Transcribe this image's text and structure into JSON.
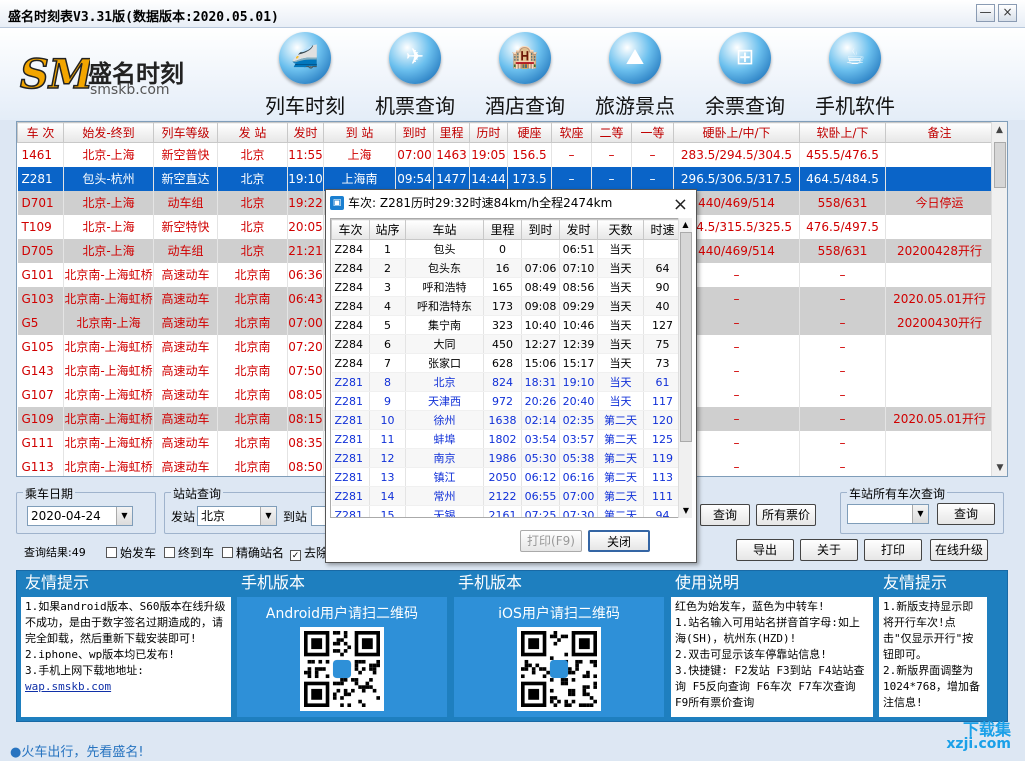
{
  "window": {
    "title": "盛名时刻表V3.31版(数据版本:2020.05.01)",
    "minimize": "—",
    "close": "×"
  },
  "logo": {
    "mark": "SM",
    "name": "盛名时刻",
    "url": "smskb.com"
  },
  "nav": [
    {
      "label": "列车时刻",
      "icon": "train-icon",
      "glyph": "🚄"
    },
    {
      "label": "机票查询",
      "icon": "airplane-icon",
      "glyph": "✈"
    },
    {
      "label": "酒店查询",
      "icon": "hotel-icon",
      "glyph": "🏨"
    },
    {
      "label": "旅游景点",
      "icon": "scenic-icon",
      "glyph": "⛰"
    },
    {
      "label": "余票查询",
      "icon": "windows-icon",
      "glyph": "⊞"
    },
    {
      "label": "手机软件",
      "icon": "java-icon",
      "glyph": "☕"
    }
  ],
  "grid": {
    "columns": [
      "车 次",
      "始发-终到",
      "列车等级",
      "发 站",
      "发时",
      "到 站",
      "到时",
      "里程",
      "历时",
      "硬座",
      "软座",
      "二等",
      "一等",
      "硬卧上/中/下",
      "软卧上/下",
      "备注"
    ],
    "rows": [
      {
        "style": "red",
        "cells": [
          "1461",
          "北京-上海",
          "新空普快",
          "北京",
          "11:55",
          "上海",
          "07:00",
          "1463",
          "19:05",
          "156.5",
          "–",
          "–",
          "–",
          "283.5/294.5/304.5",
          "455.5/476.5",
          ""
        ]
      },
      {
        "style": "sel",
        "cells": [
          "Z281",
          "包头-杭州",
          "新空直达",
          "北京",
          "19:10",
          "上海南",
          "09:54",
          "1477",
          "14:44",
          "173.5",
          "–",
          "–",
          "–",
          "296.5/306.5/317.5",
          "464.5/484.5",
          ""
        ]
      },
      {
        "style": "red gray",
        "cells": [
          "D701",
          "北京-上海",
          "动车组",
          "北京",
          "19:22",
          "",
          "",
          "",
          "",
          "",
          "",
          "",
          "",
          "440/469/514",
          "558/631",
          "今日停运"
        ]
      },
      {
        "style": "red",
        "cells": [
          "T109",
          "北京-上海",
          "新空特快",
          "北京",
          "20:05",
          "",
          "",
          "",
          "",
          "",
          "",
          "",
          "",
          "304.5/315.5/325.5",
          "476.5/497.5",
          ""
        ]
      },
      {
        "style": "red gray",
        "cells": [
          "D705",
          "北京-上海",
          "动车组",
          "北京",
          "21:21",
          "",
          "",
          "",
          "",
          "",
          "",
          "",
          "",
          "440/469/514",
          "558/631",
          "20200428开行"
        ]
      },
      {
        "style": "red",
        "cells": [
          "G101",
          "北京南-上海虹桥",
          "高速动车",
          "北京南",
          "06:36",
          "",
          "",
          "",
          "",
          "",
          "",
          "",
          "",
          "–",
          "–",
          ""
        ]
      },
      {
        "style": "red gray",
        "cells": [
          "G103",
          "北京南-上海虹桥",
          "高速动车",
          "北京南",
          "06:43",
          "",
          "",
          "",
          "",
          "",
          "",
          "",
          "",
          "–",
          "–",
          "2020.05.01开行"
        ]
      },
      {
        "style": "red gray",
        "cells": [
          "G5",
          "北京南-上海",
          "高速动车",
          "北京南",
          "07:00",
          "",
          "",
          "",
          "",
          "",
          "",
          "",
          "",
          "–",
          "–",
          "20200430开行"
        ]
      },
      {
        "style": "red",
        "cells": [
          "G105",
          "北京南-上海虹桥",
          "高速动车",
          "北京南",
          "07:20",
          "",
          "",
          "",
          "",
          "",
          "",
          "",
          "",
          "–",
          "–",
          ""
        ]
      },
      {
        "style": "red",
        "cells": [
          "G143",
          "北京南-上海虹桥",
          "高速动车",
          "北京南",
          "07:50",
          "",
          "",
          "",
          "",
          "",
          "",
          "",
          "",
          "–",
          "–",
          ""
        ]
      },
      {
        "style": "red",
        "cells": [
          "G107",
          "北京南-上海虹桥",
          "高速动车",
          "北京南",
          "08:05",
          "",
          "",
          "",
          "",
          "",
          "",
          "",
          "",
          "–",
          "–",
          ""
        ]
      },
      {
        "style": "red gray",
        "cells": [
          "G109",
          "北京南-上海虹桥",
          "高速动车",
          "北京南",
          "08:15",
          "",
          "",
          "",
          "",
          "",
          "",
          "",
          "",
          "–",
          "–",
          "2020.05.01开行"
        ]
      },
      {
        "style": "red",
        "cells": [
          "G111",
          "北京南-上海虹桥",
          "高速动车",
          "北京南",
          "08:35",
          "",
          "",
          "",
          "",
          "",
          "",
          "",
          "",
          "–",
          "–",
          ""
        ]
      },
      {
        "style": "red",
        "cells": [
          "G113",
          "北京南-上海虹桥",
          "高速动车",
          "北京南",
          "08:50",
          "",
          "",
          "",
          "",
          "",
          "",
          "",
          "",
          "–",
          "–",
          ""
        ]
      }
    ]
  },
  "filters": {
    "date_group": "乘车日期",
    "date_value": "2020-04-24",
    "station_group": "站站查询",
    "from_label": "发站",
    "from_value": "北京",
    "to_label": "到站",
    "query_button": "查询",
    "all_prices_button": "所有票价",
    "station_all_group": "车站所有车次查询",
    "station_query_button": "查询",
    "result_label": "查询结果:49",
    "check_origin": "始发车",
    "check_terminal": "终到车",
    "check_exact": "精确站名",
    "check_other": "去除",
    "export_button": "导出",
    "about_button": "关于",
    "print_button": "打印",
    "upgrade_button": "在线升级"
  },
  "popup": {
    "title": "车次: Z281历时29:32时速84km/h全程2474km",
    "columns": [
      "车次",
      "站序",
      "车站",
      "里程",
      "到时",
      "发时",
      "天数",
      "时速"
    ],
    "rows": [
      {
        "c": [
          "Z284",
          "1",
          "包头",
          "0",
          "",
          "06:51",
          "当天",
          ""
        ],
        "blue": false
      },
      {
        "c": [
          "Z284",
          "2",
          "包头东",
          "16",
          "07:06",
          "07:10",
          "当天",
          "64"
        ],
        "blue": false
      },
      {
        "c": [
          "Z284",
          "3",
          "呼和浩特",
          "165",
          "08:49",
          "08:56",
          "当天",
          "90"
        ],
        "blue": false
      },
      {
        "c": [
          "Z284",
          "4",
          "呼和浩特东",
          "173",
          "09:08",
          "09:29",
          "当天",
          "40"
        ],
        "blue": false
      },
      {
        "c": [
          "Z284",
          "5",
          "集宁南",
          "323",
          "10:40",
          "10:46",
          "当天",
          "127"
        ],
        "blue": false
      },
      {
        "c": [
          "Z284",
          "6",
          "大同",
          "450",
          "12:27",
          "12:39",
          "当天",
          "75"
        ],
        "blue": false
      },
      {
        "c": [
          "Z284",
          "7",
          "张家口",
          "628",
          "15:06",
          "15:17",
          "当天",
          "73"
        ],
        "blue": false
      },
      {
        "c": [
          "Z281",
          "8",
          "北京",
          "824",
          "18:31",
          "19:10",
          "当天",
          "61"
        ],
        "blue": true
      },
      {
        "c": [
          "Z281",
          "9",
          "天津西",
          "972",
          "20:26",
          "20:40",
          "当天",
          "117"
        ],
        "blue": true
      },
      {
        "c": [
          "Z281",
          "10",
          "徐州",
          "1638",
          "02:14",
          "02:35",
          "第二天",
          "120"
        ],
        "blue": true
      },
      {
        "c": [
          "Z281",
          "11",
          "蚌埠",
          "1802",
          "03:54",
          "03:57",
          "第二天",
          "125"
        ],
        "blue": true
      },
      {
        "c": [
          "Z281",
          "12",
          "南京",
          "1986",
          "05:30",
          "05:38",
          "第二天",
          "119"
        ],
        "blue": true
      },
      {
        "c": [
          "Z281",
          "13",
          "镇江",
          "2050",
          "06:12",
          "06:16",
          "第二天",
          "113"
        ],
        "blue": true
      },
      {
        "c": [
          "Z281",
          "14",
          "常州",
          "2122",
          "06:55",
          "07:00",
          "第二天",
          "111"
        ],
        "blue": true
      },
      {
        "c": [
          "Z281",
          "15",
          "无锡",
          "2161",
          "07:25",
          "07:30",
          "第二天",
          "94"
        ],
        "blue": true
      }
    ],
    "print_button": "打印(F9)",
    "close_button": "关闭"
  },
  "info": {
    "p1_title": "友情提示",
    "p1_body": "1.如果android版本、S60版本在线升级不成功，是由于数字签名过期造成的，请完全卸载，然后重新下载安装即可!\n2.iphone、wp版本均已发布!\n3.手机上网下载地地址:",
    "p1_link": "wap.smskb.com",
    "p2_title": "手机版本",
    "p2_qr": "Android用户请扫二维码",
    "p3_title": "手机版本",
    "p3_qr": "iOS用户请扫二维码",
    "p4_title": "使用说明",
    "p4_body": "红色为始发车，蓝色为中转车!\n1.站名输入可用站名拼音首字母:如上海(SH)，杭州东(HZD)!\n2.双击可显示该车停靠站信息!\n3.快捷键: F2发站 F3到站 F4站站查询 F5反向查询 F6车次 F7车次查询 F9所有票价查询",
    "p5_title": "友情提示",
    "p5_body": "1.新版支持显示即将开行车次!点击\"仅显示开行\"按钮即可。\n2.新版界面调整为1024*768，增加备注信息!"
  },
  "status": "●火车出行，先看盛名!",
  "watermark": {
    "brand": "下载集",
    "url": "xzji.com"
  }
}
